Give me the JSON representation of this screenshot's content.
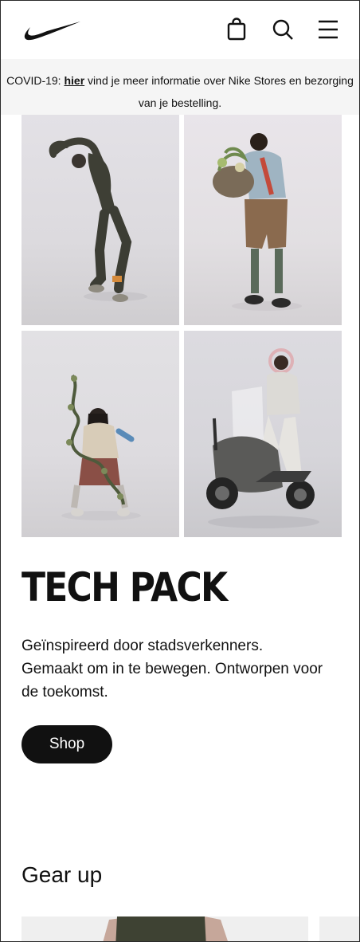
{
  "header": {
    "logo": "nike-swoosh-logo",
    "icons": [
      "shopping-bag-icon",
      "search-icon",
      "menu-icon"
    ]
  },
  "banner": {
    "prefix": "COVID-19: ",
    "link": "hier",
    "suffix": " vind je meer informatie over Nike Stores en bezorging van je bestelling."
  },
  "hero": {
    "title": "TECH PACK",
    "description": "Geïnspireerd door stadsverkenners. Gemaakt om in te bewegen. Ontworpen voor de toekomst.",
    "cta_label": "Shop"
  },
  "gear": {
    "heading": "Gear up"
  },
  "colors": {
    "text": "#111111",
    "banner_bg": "#f5f5f5",
    "button_bg": "#111111",
    "button_text": "#ffffff"
  }
}
